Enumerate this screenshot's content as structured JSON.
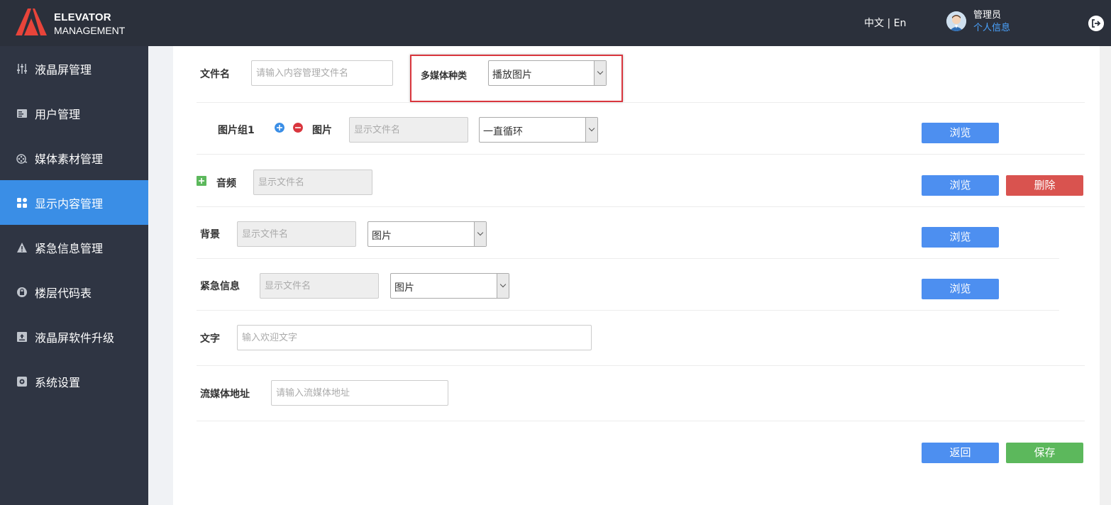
{
  "header": {
    "brand_line1": "ELEVATOR",
    "brand_line2": "MANAGEMENT",
    "lang_zh": "中文",
    "lang_sep": " | ",
    "lang_en": "En",
    "user_role": "管理员",
    "user_info_link": "个人信息"
  },
  "sidebar": {
    "items": [
      {
        "label": "液晶屏管理",
        "icon": "sliders-icon"
      },
      {
        "label": "用户管理",
        "icon": "user-card-icon"
      },
      {
        "label": "媒体素材管理",
        "icon": "film-reel-icon"
      },
      {
        "label": "显示内容管理",
        "icon": "grid-icon",
        "active": true
      },
      {
        "label": "紧急信息管理",
        "icon": "warning-icon"
      },
      {
        "label": "楼层代码表",
        "icon": "lock-icon"
      },
      {
        "label": "液晶屏软件升级",
        "icon": "upload-icon"
      },
      {
        "label": "系统设置",
        "icon": "settings-icon"
      }
    ]
  },
  "form": {
    "filename_label": "文件名",
    "filename_placeholder": "请输入内容管理文件名",
    "media_type_label": "多媒体种类",
    "media_type_value": "播放图片",
    "image_group_label": "图片组1",
    "image_label": "图片",
    "image_file_placeholder": "显示文件名",
    "image_loop_value": "一直循环",
    "audio_label": "音频",
    "audio_file_placeholder": "显示文件名",
    "background_label": "背景",
    "background_file_placeholder": "显示文件名",
    "background_type_value": "图片",
    "emergency_label": "紧急信息",
    "emergency_file_placeholder": "显示文件名",
    "emergency_type_value": "图片",
    "text_label": "文字",
    "text_placeholder": "输入欢迎文字",
    "stream_label": "流媒体地址",
    "stream_placeholder": "请输入流媒体地址"
  },
  "buttons": {
    "browse": "浏览",
    "delete": "删除",
    "back": "返回",
    "save": "保存"
  },
  "colors": {
    "header_bg": "#2b303b",
    "sidebar_bg": "#2f3543",
    "active_item": "#3a8ee6",
    "browse_btn": "#4d8ff0",
    "delete_btn": "#d9534f",
    "save_btn": "#5cb85c",
    "highlight_border": "#d9363e"
  }
}
